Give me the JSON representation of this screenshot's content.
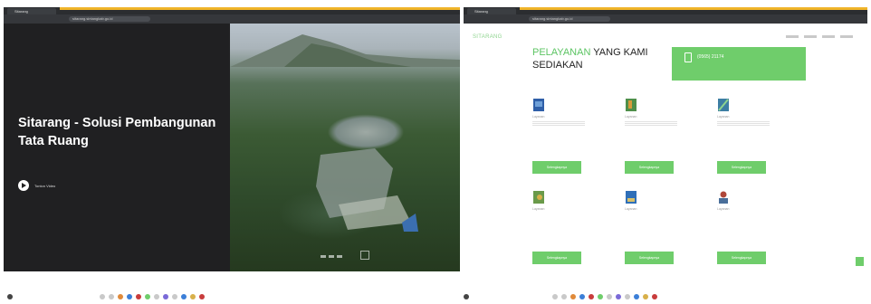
{
  "left_window": {
    "tab_title": "Sitarang",
    "url": "sitarang.sintangkab.go.id",
    "hero": {
      "title_line1": "Sitarang - Solusi Pembangunan",
      "title_line2": "Tata Ruang",
      "play_label": "Tonton Video"
    }
  },
  "right_window": {
    "tab_title": "Sitarang",
    "url": "sitarang.sintangkab.go.id",
    "logo": "SITARANG",
    "heading_highlight": "PELAYANAN",
    "heading_rest": " YANG KAMI",
    "heading_line2": "SEDIAKAN",
    "contact_phone": "(0565) 21174",
    "services": [
      {
        "name": "Layanan",
        "button": "Selengkapnya",
        "icon": "map-icon"
      },
      {
        "name": "Layanan",
        "button": "Selengkapnya",
        "icon": "map-icon"
      },
      {
        "name": "Layanan",
        "button": "Selengkapnya",
        "icon": "map-icon"
      },
      {
        "name": "Layanan",
        "button": "Selengkapnya",
        "icon": "map-icon"
      },
      {
        "name": "Layanan",
        "button": "Selengkapnya",
        "icon": "map-icon"
      },
      {
        "name": "Layanan",
        "button": "Selengkapnya",
        "icon": "user-icon"
      }
    ]
  },
  "colors": {
    "accent_green": "#6fcd6b",
    "browser_accent": "#f0b429",
    "hero_dark": "#202022"
  }
}
